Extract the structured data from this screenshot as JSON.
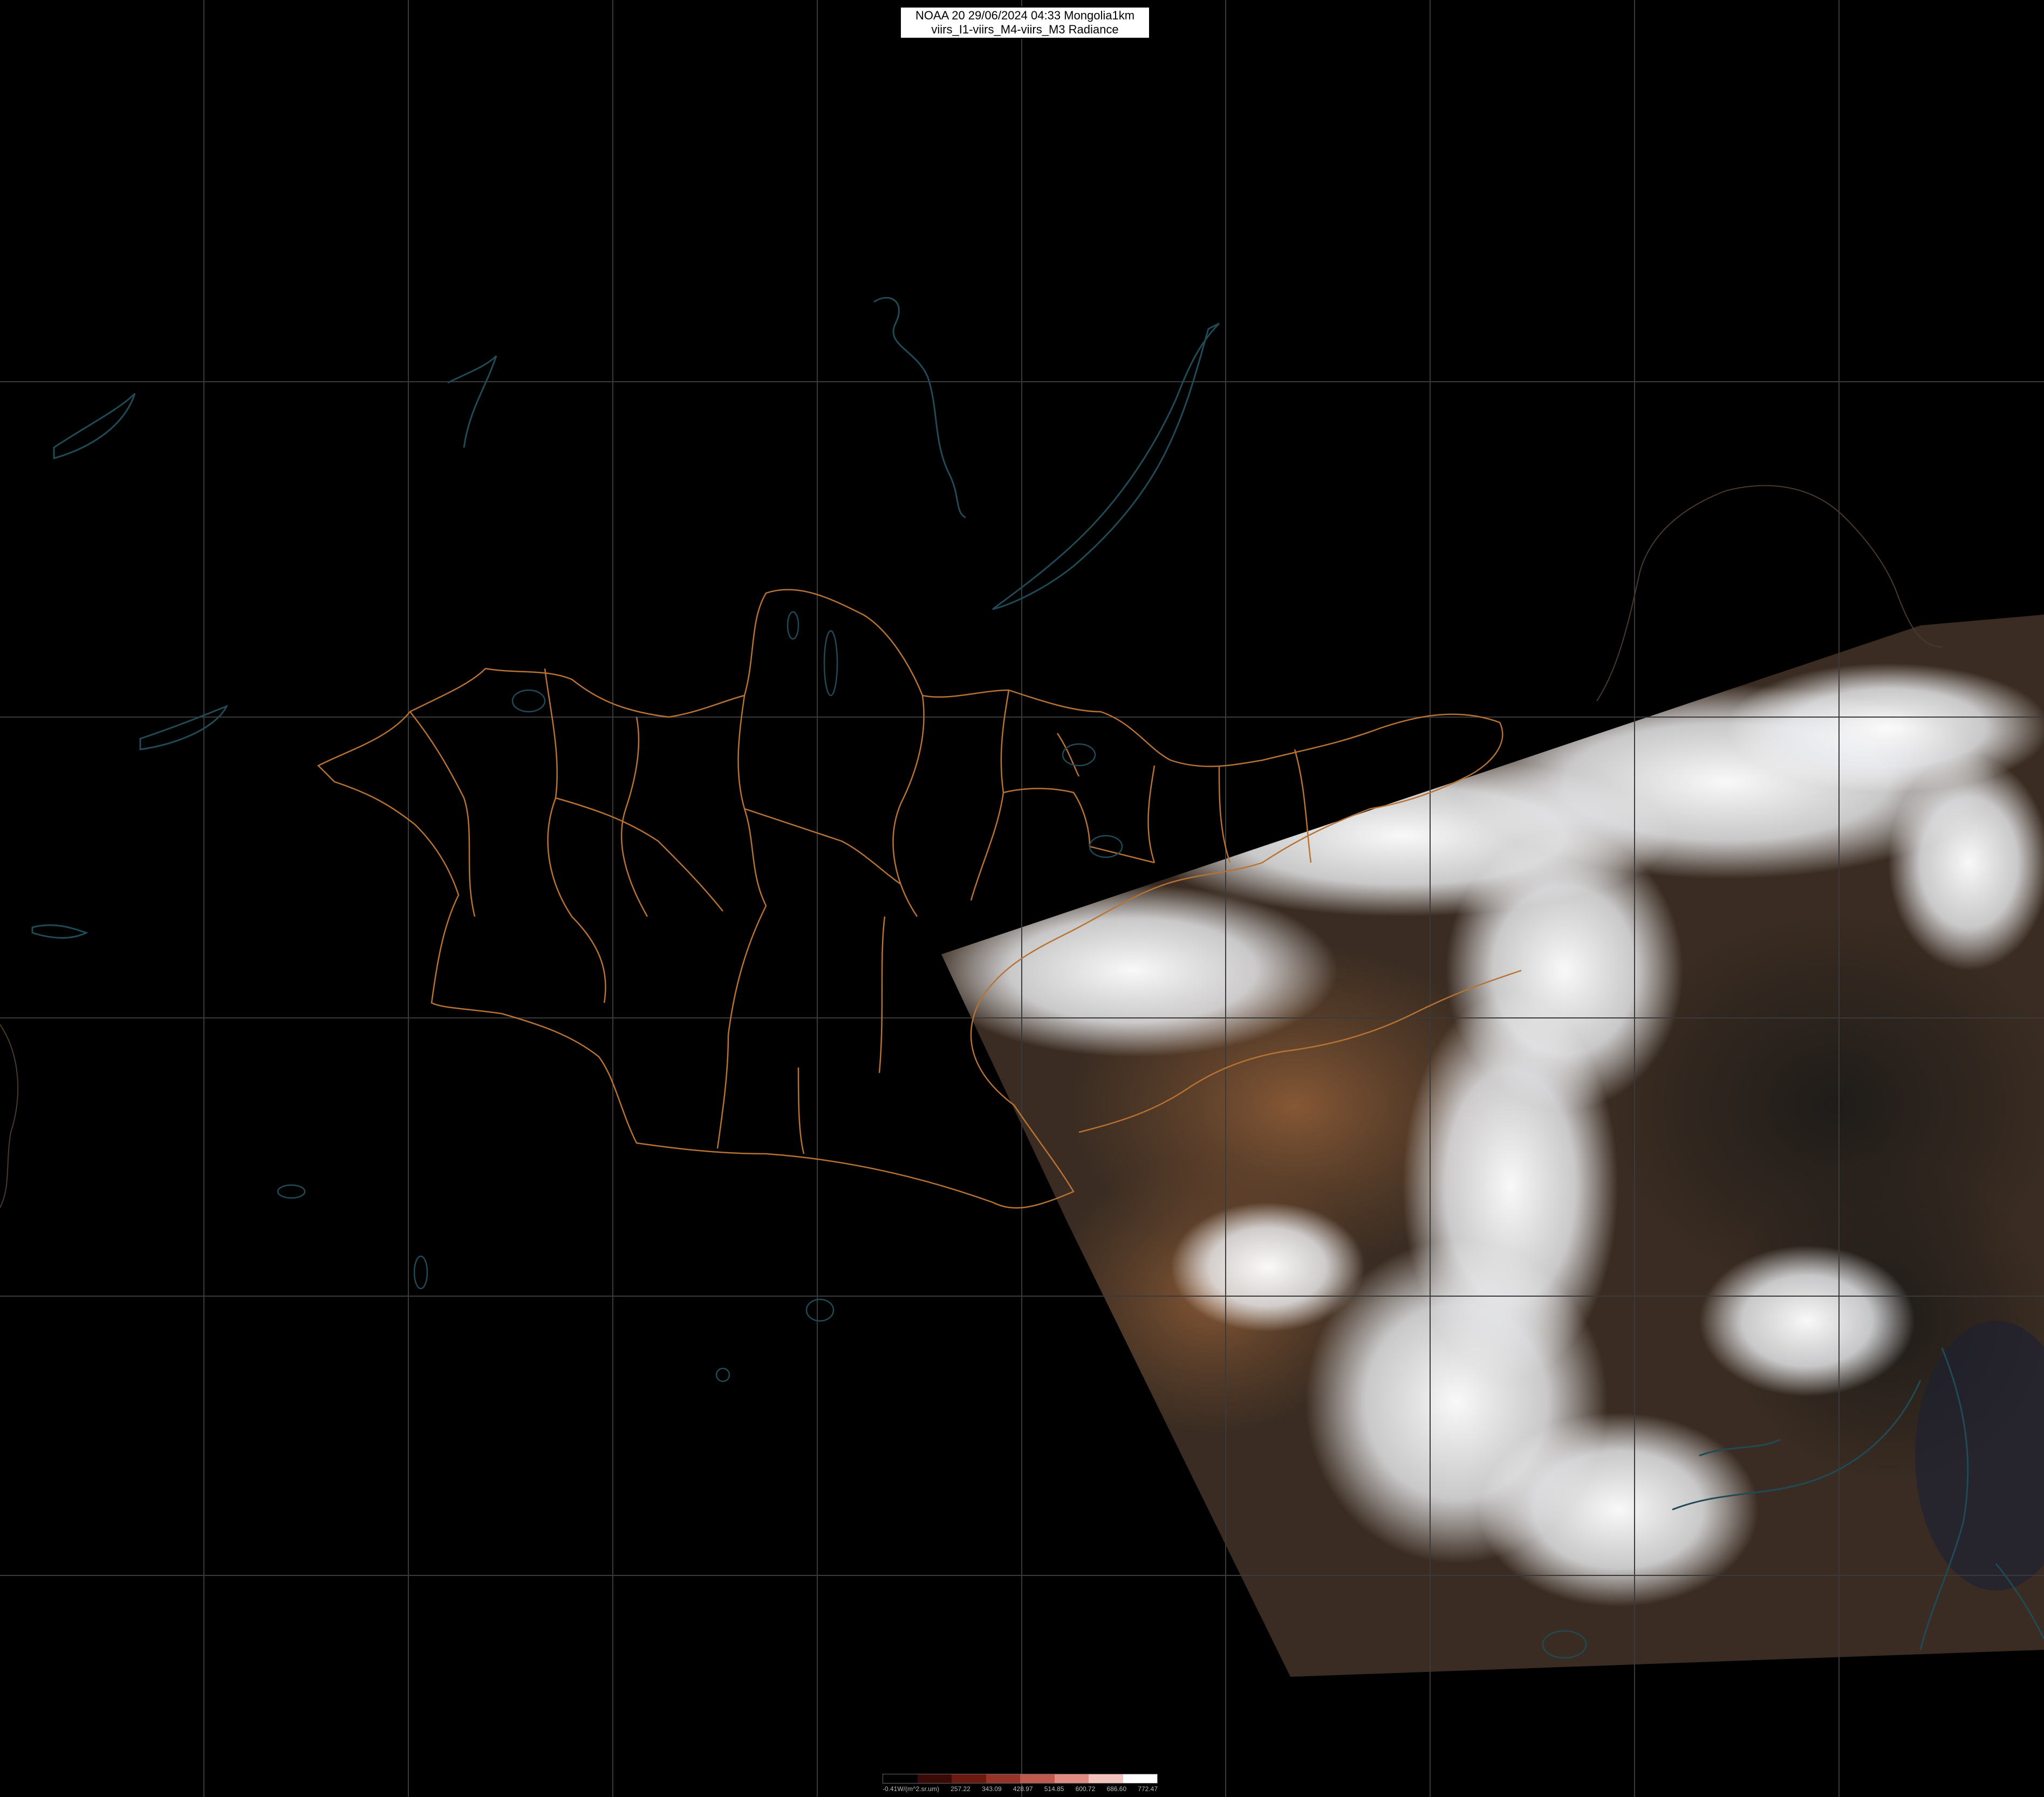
{
  "title": {
    "line1": "NOAA 20 29/06/2024 04:33 Mongolia1km",
    "line2": "viirs_I1-viirs_M4-viirs_M3 Radiance"
  },
  "colors": {
    "background": "#000000",
    "graticule": "#3a3a3a",
    "admin_border": "#b87333",
    "coastline": "#1f4a56",
    "cloud": "#f3f5f8",
    "land_brown": "#6e4a2e",
    "land_dark": "#2c2620"
  },
  "legend": {
    "labels": [
      "-0.41W/(m^2.sr.um)",
      "257.22",
      "343.09",
      "428.97",
      "514.85",
      "600.72",
      "686.60",
      "772.47"
    ],
    "colors": [
      "#000000",
      "#3a0a06",
      "#6a1a10",
      "#96342a",
      "#c05a4e",
      "#e08c82",
      "#f4c2bc",
      "#ffffff"
    ]
  }
}
